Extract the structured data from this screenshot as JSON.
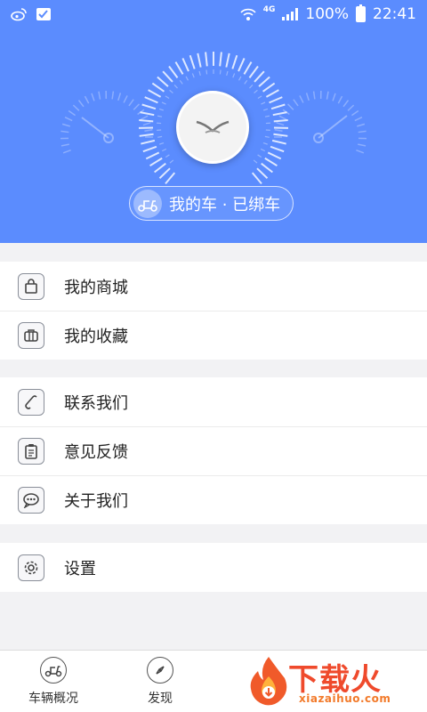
{
  "status_bar": {
    "battery": "100%",
    "time": "22:41",
    "network": "4G"
  },
  "header": {
    "car_status": "我的车 · 已绑车"
  },
  "menu_groups": [
    {
      "items": [
        {
          "label": "我的商城",
          "icon": "shopping-bag-icon"
        },
        {
          "label": "我的收藏",
          "icon": "briefcase-icon"
        }
      ]
    },
    {
      "items": [
        {
          "label": "联系我们",
          "icon": "phone-icon"
        },
        {
          "label": "意见反馈",
          "icon": "clipboard-icon"
        },
        {
          "label": "关于我们",
          "icon": "chat-bubble-icon"
        }
      ]
    },
    {
      "items": [
        {
          "label": "设置",
          "icon": "gear-icon"
        }
      ]
    }
  ],
  "tabbar": {
    "tabs": [
      {
        "label": "车辆概况",
        "icon": "scooter-icon"
      },
      {
        "label": "发现",
        "icon": "compass-icon"
      }
    ]
  },
  "watermark": {
    "text": "下载火",
    "subtext": "xiazaihuo.com"
  },
  "colors": {
    "header_bg": "#5b8cfe",
    "page_bg": "#f2f2f4",
    "watermark": "#ef4a2c"
  }
}
